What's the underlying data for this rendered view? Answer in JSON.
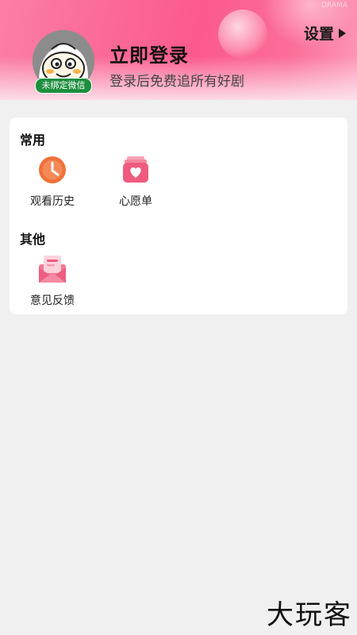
{
  "status_bar": {
    "watermark": "DRAMA"
  },
  "header": {
    "settings_label": "设置",
    "login_title": "立即登录",
    "login_subtitle": "登录后免费追所有好剧",
    "avatar_badge": "未绑定微信"
  },
  "sections": [
    {
      "title": "常用",
      "items": [
        {
          "label": "观看历史",
          "icon": "clock-icon"
        },
        {
          "label": "心愿单",
          "icon": "heart-box-icon"
        }
      ]
    },
    {
      "title": "其他",
      "items": [
        {
          "label": "意见反馈",
          "icon": "feedback-mail-icon"
        }
      ]
    }
  ],
  "footer": {
    "watermark": "大玩客"
  },
  "colors": {
    "accent_pink": "#f0587e",
    "clock_orange": "#f2703a",
    "badge_green": "#1e8f3e",
    "page_bg": "#f0f0f0"
  }
}
